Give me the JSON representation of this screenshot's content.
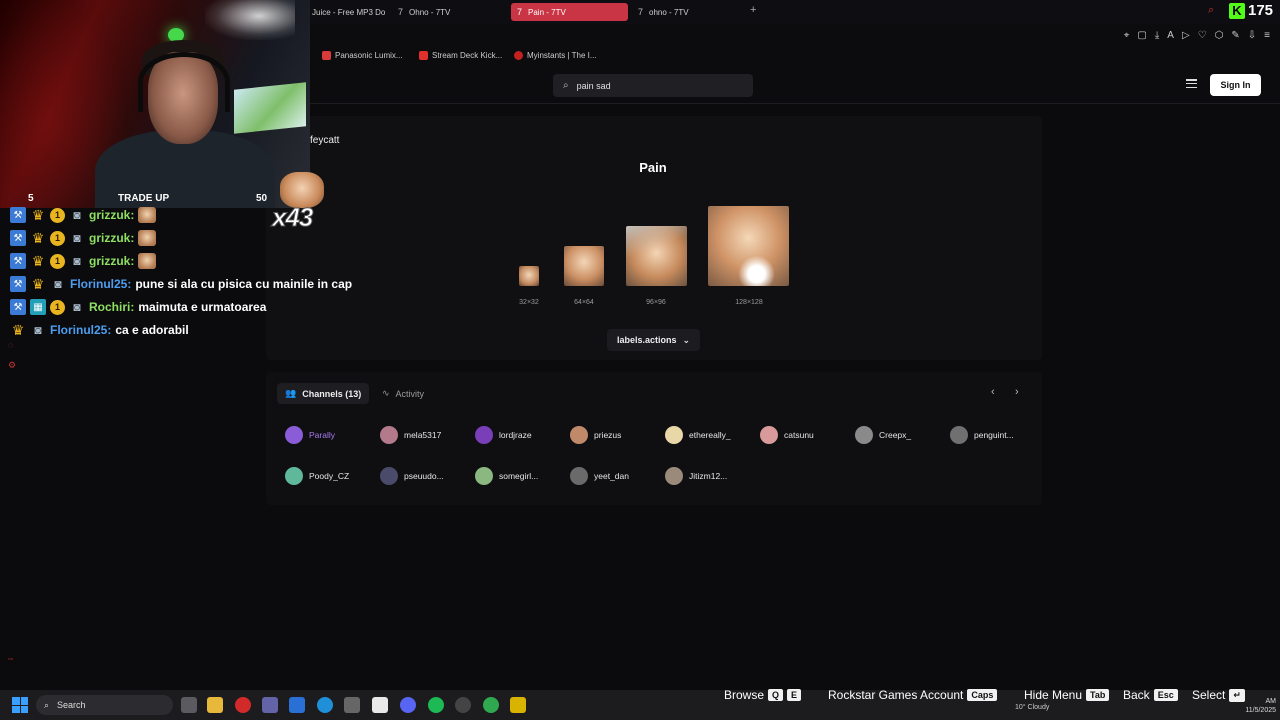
{
  "browser": {
    "tabs": [
      {
        "label": "Juice - Free MP3 Do",
        "active": false
      },
      {
        "label": "Ohno - 7TV",
        "active": false
      },
      {
        "label": "Pain - 7TV",
        "active": true
      },
      {
        "label": "ohno - 7TV",
        "active": false
      }
    ],
    "new_tab": "+",
    "bookmarks": [
      {
        "label": "Panasonic Lumix...",
        "color": "#d93a3a"
      },
      {
        "label": "Stream Deck Kick...",
        "color": "#e0302c"
      },
      {
        "label": "Myinstants | The I...",
        "color": "#c42020"
      }
    ]
  },
  "overlay": {
    "kick_count": "175",
    "tradeup": {
      "left": "5",
      "center": "TRADE UP",
      "right": "50"
    },
    "emote_combo": "x43"
  },
  "chat": [
    {
      "user": "grizzuk:",
      "user_color": "#8ee063",
      "message": "",
      "emote": true,
      "badges": [
        "pin",
        "crown",
        "coin",
        "cam"
      ]
    },
    {
      "user": "grizzuk:",
      "user_color": "#8ee063",
      "message": "",
      "emote": true,
      "badges": [
        "pin",
        "crown",
        "coin",
        "cam"
      ]
    },
    {
      "user": "grizzuk:",
      "user_color": "#8ee063",
      "message": "",
      "emote": true,
      "badges": [
        "pin",
        "crown",
        "coin",
        "cam"
      ]
    },
    {
      "user": "Florinul25:",
      "user_color": "#4d9df0",
      "message": "pune si ala cu pisica cu mainile in cap",
      "emote": false,
      "badges": [
        "pin",
        "crown",
        "cam"
      ]
    },
    {
      "user": "Rochiri:",
      "user_color": "#8ee063",
      "message": "maimuta e urmatoarea",
      "emote": false,
      "badges": [
        "pin",
        "gift",
        "coin",
        "cam"
      ]
    },
    {
      "user": "Florinul25:",
      "user_color": "#4d9df0",
      "message": "ca e adorabil",
      "emote": false,
      "badges": [
        "crown",
        "cam"
      ]
    }
  ],
  "site": {
    "search_value": "pain sad",
    "sign_in": "Sign In"
  },
  "emote": {
    "uploader": "feycatt",
    "title": "Pain",
    "sizes": [
      "32×32",
      "64×64",
      "96×96",
      "128×128"
    ],
    "actions_label": "labels.actions"
  },
  "channels": {
    "tab_channels": "Channels (13)",
    "tab_activity": "Activity",
    "list": [
      {
        "name": "Parally",
        "color": "#8a5cd8",
        "highlight": true
      },
      {
        "name": "mela5317",
        "color": "#b27a8a"
      },
      {
        "name": "lordjraze",
        "color": "#7a3fb8"
      },
      {
        "name": "priezus",
        "color": "#c08a6a"
      },
      {
        "name": "ethereally_",
        "color": "#e8d8a8"
      },
      {
        "name": "catsunu",
        "color": "#d89a9a"
      },
      {
        "name": "Creepx_",
        "color": "#8a8a8a"
      },
      {
        "name": "penguint...",
        "color": "#707070"
      },
      {
        "name": "Poody_CZ",
        "color": "#5fb89a"
      },
      {
        "name": "pseuudo...",
        "color": "#4a4a6a"
      },
      {
        "name": "somegirl...",
        "color": "#8ab880"
      },
      {
        "name": "yeet_dan",
        "color": "#6a6a6a"
      },
      {
        "name": "Jitizm12...",
        "color": "#9a8a7a"
      }
    ]
  },
  "taskbar": {
    "search": "Search",
    "weather_temp": "10°",
    "weather_desc": "Cloudy",
    "time": "AM",
    "date": "11/5/2025"
  },
  "hints": [
    {
      "label": "Browse",
      "keys": [
        "Q",
        "E"
      ]
    },
    {
      "label": "Rockstar Games Account",
      "keys": [
        "Caps"
      ]
    },
    {
      "label": "Hide Menu",
      "keys": [
        "Tab"
      ]
    },
    {
      "label": "Back",
      "keys": [
        "Esc"
      ]
    },
    {
      "label": "Select",
      "keys": [
        "↵"
      ]
    }
  ]
}
